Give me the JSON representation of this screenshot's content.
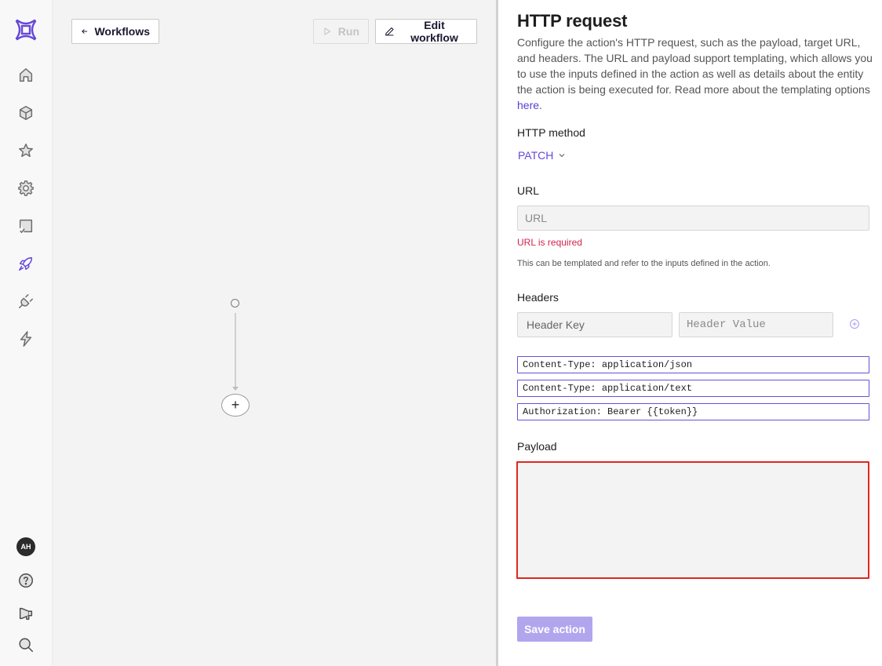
{
  "sidebar": {
    "logo": "brand-logo",
    "items": [
      {
        "name": "home",
        "icon": "home-icon",
        "active": false
      },
      {
        "name": "catalog",
        "icon": "cube-icon",
        "active": false
      },
      {
        "name": "favorites",
        "icon": "star-icon",
        "active": false
      },
      {
        "name": "settings",
        "icon": "gear-icon",
        "active": false
      },
      {
        "name": "tasks",
        "icon": "checkbox-icon",
        "active": false
      },
      {
        "name": "workflows",
        "icon": "rocket-icon",
        "active": true
      },
      {
        "name": "integrations",
        "icon": "plug-icon",
        "active": false
      },
      {
        "name": "automations",
        "icon": "lightning-icon",
        "active": false
      }
    ],
    "bottom": {
      "avatar_initials": "AH",
      "help": "help-icon",
      "announcements": "megaphone-icon",
      "search": "search-icon"
    },
    "accent": "#6547d8"
  },
  "canvas": {
    "back_label": "Workflows",
    "run_label": "Run",
    "edit_label": "Edit workflow",
    "add_node_label": "+"
  },
  "panel": {
    "title": "HTTP request",
    "description": "Configure the action's HTTP request, such as the payload, target URL, and headers. The URL and payload support templating, which allows you to use the inputs defined in the action as well as details about the entity the action is being executed for. Read more about the templating options ",
    "description_link": "here",
    "description_end": ".",
    "method_label": "HTTP method",
    "method_value": "PATCH",
    "url_label": "URL",
    "url_placeholder": "URL",
    "url_value": "",
    "url_error": "URL is required",
    "url_help": "This can be templated and refer to the inputs defined in the action.",
    "headers_label": "Headers",
    "header_key_placeholder": "Header Key",
    "header_value_placeholder": "Header Value",
    "headers": [
      "Content-Type: application/json",
      "Content-Type: application/text",
      "Authorization: Bearer {{token}}"
    ],
    "payload_label": "Payload",
    "payload_value": "",
    "save_label": "Save action",
    "error_color": "#e0271e"
  }
}
